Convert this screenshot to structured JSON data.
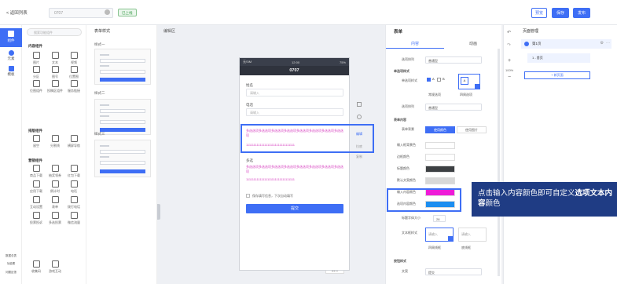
{
  "topbar": {
    "back_label": "< 返回列表",
    "form_name": "0707",
    "status_badge": "已上线",
    "preview_label": "预览",
    "save_label": "保存",
    "publish_label": "发布"
  },
  "rail": {
    "items": [
      "组件",
      "元素",
      "模板"
    ],
    "bottom": [
      "数据总表",
      "功能覆",
      "问题反馈"
    ]
  },
  "library": {
    "search_placeholder": "搜索功能组件",
    "sections": [
      {
        "title": "内容组件",
        "items": [
          "图片",
          "文本",
          "视频",
          "分区",
          "图号",
          "位置图",
          "位图组件",
          "投稿区组件",
          "服务链接"
        ]
      },
      {
        "title": "排版组件",
        "items": [
          "留空",
          "分割线",
          "横屏导航"
        ]
      },
      {
        "title": "营销组件",
        "items": [
          "商品下载",
          "抽奖领券",
          "红包下载",
          "应用下载",
          "倒计时",
          "电话",
          "互动设置",
          "表单",
          "拨打电话",
          "投票投诉",
          "多选投票",
          "微信流量"
        ]
      },
      {
        "title": "",
        "items": [
          "收集码",
          "游戏互动"
        ]
      }
    ]
  },
  "templates": {
    "title": "表单样式",
    "styles": [
      "样式一",
      "样式二",
      "样式三"
    ]
  },
  "canvas": {
    "title": "编辑区",
    "zoom": "64%"
  },
  "phone": {
    "carrier": "无SIM",
    "time": "12:00",
    "battery": "75%",
    "title": "0707",
    "name_label": "姓名",
    "name_placeholder": "请输入",
    "phone_label": "电话",
    "phone_placeholder": "请输入",
    "multi_text": "多选选项多选选项多选选项多选选项多选选项多选选项多选选项多选选项",
    "multi_placeholder": "11111111111111111111111111111111",
    "second_label": "多选",
    "second_text": "多选选项多选选项多选选项多选选项多选选项多选选项多选选项多选选项",
    "second_placeholder": "11111111111111111111111111111111",
    "checkbox_text": "保存填写信息，下次自动填写",
    "submit_label": "提交"
  },
  "side_tools": [
    "编辑",
    "拉底",
    "复制"
  ],
  "right_panel": {
    "title": "表单",
    "tabs": [
      "内容",
      "动画"
    ],
    "rows": [
      {
        "label": "选项排列",
        "value": "普通型"
      },
      {
        "label": "单选项样式",
        "value": ""
      },
      {
        "label": "选项排列",
        "value": "普通型"
      }
    ],
    "section2": "单选项样式",
    "opt_labels": [
      "常规选项",
      "四周选项"
    ],
    "content_section": "表单内容",
    "content_bg_label": "表单背景",
    "content_bg_options": [
      "使用颜色",
      "使用图片"
    ],
    "colors": [
      {
        "label": "输入框背景色",
        "color": "#ffffff"
      },
      {
        "label": "边框颜色",
        "color": "#ffffff"
      },
      {
        "label": "标题颜色",
        "color": "#3d4043"
      },
      {
        "label": "默认文案颜色",
        "color": "#d8d8d8"
      },
      {
        "label": "输入内容颜色",
        "color": "#ee1bd8"
      },
      {
        "label": "选项内容颜色",
        "color": "#1c8ef0"
      }
    ],
    "font_size_label": "标题字体大小",
    "font_size": "28",
    "text_style_label": "文本框样式",
    "text_style_opts": [
      "四周线框",
      "底线框"
    ],
    "text_style_placeholders": [
      "请输入",
      "请输入"
    ],
    "btn_style": "按钮样式",
    "text_label": "文案",
    "text_value": "提交"
  },
  "pages": {
    "title": "页面管理",
    "page1": "第1页",
    "page1_sub": "1 - 首页",
    "add_page": "+ 新页面",
    "zoom": "100%"
  },
  "callout": {
    "line_prefix": "点击输入内容颜色即可自定义",
    "bold": "选项文本内容",
    "suffix": "颜色"
  }
}
